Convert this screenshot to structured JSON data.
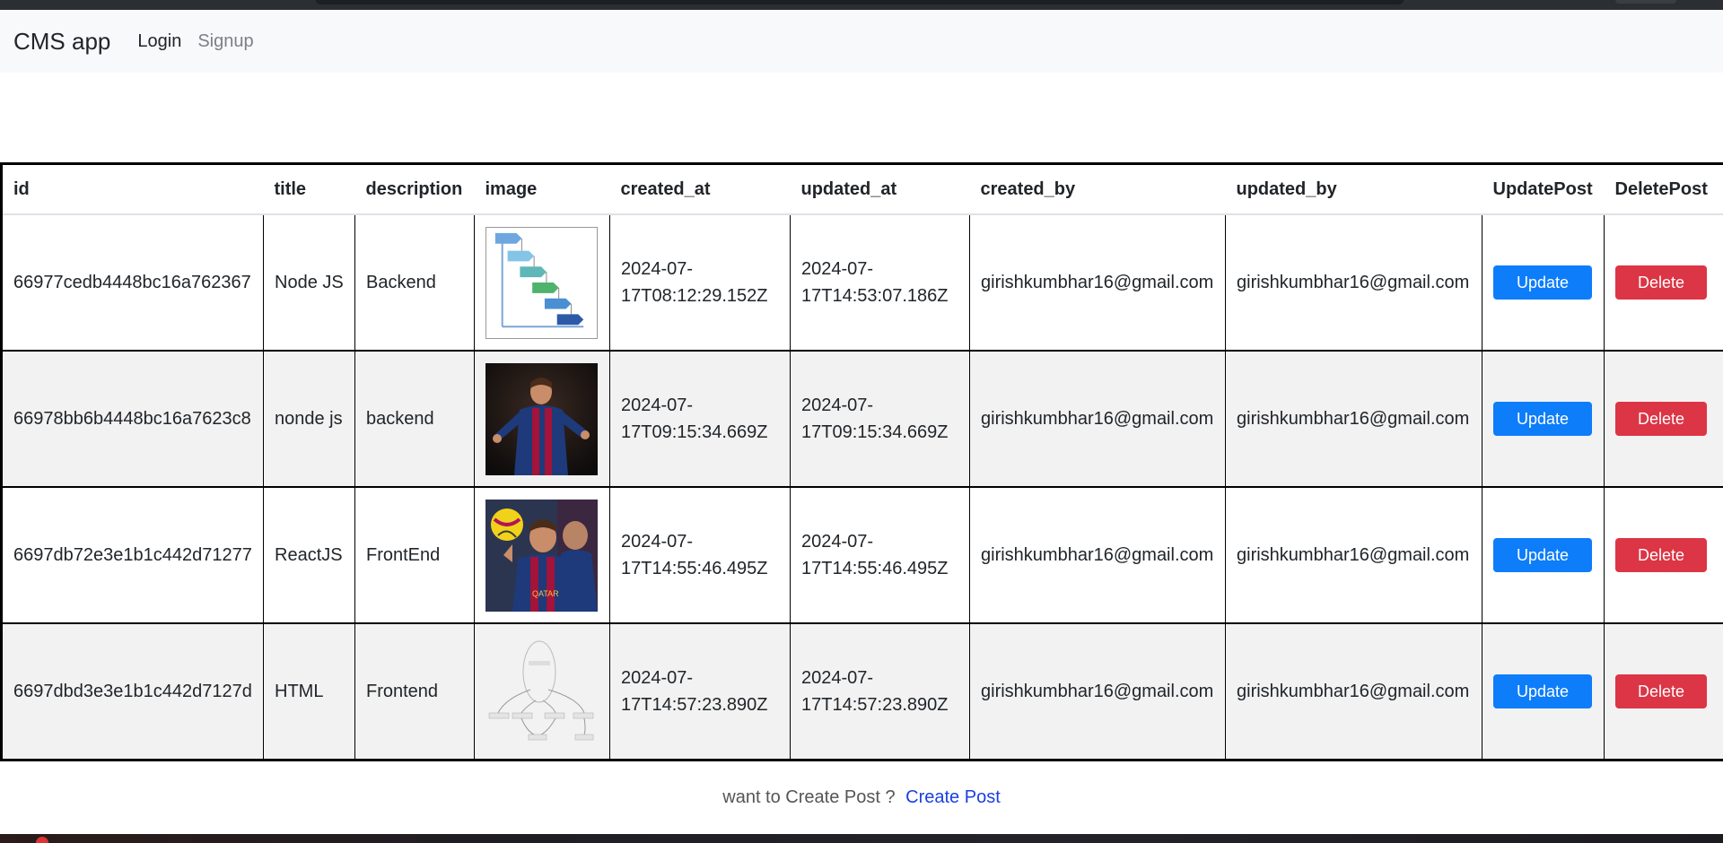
{
  "navbar": {
    "brand": "CMS app",
    "links": [
      "Login",
      "Signup"
    ]
  },
  "table": {
    "columns": [
      "id",
      "title",
      "description",
      "image",
      "created_at",
      "updated_at",
      "created_by",
      "updated_by",
      "UpdatePost",
      "DeletePost"
    ],
    "rows": [
      {
        "id": "66977cedb4448bc16a762367",
        "title": "Node JS",
        "description": "Backend",
        "image": "waterfall-diagram",
        "created_at": "2024-07-17T08:12:29.152Z",
        "updated_at": "2024-07-17T14:53:07.186Z",
        "created_by": "girishkumbhar16@gmail.com",
        "updated_by": "girishkumbhar16@gmail.com"
      },
      {
        "id": "66978bb6b4448bc16a7623c8",
        "title": "nonde js",
        "description": "backend",
        "image": "football-player-photo",
        "created_at": "2024-07-17T09:15:34.669Z",
        "updated_at": "2024-07-17T09:15:34.669Z",
        "created_by": "girishkumbhar16@gmail.com",
        "updated_by": "girishkumbhar16@gmail.com"
      },
      {
        "id": "6697db72e3e1b1c442d71277",
        "title": "ReactJS",
        "description": "FrontEnd",
        "image": "football-player-with-ball-photo",
        "created_at": "2024-07-17T14:55:46.495Z",
        "updated_at": "2024-07-17T14:55:46.495Z",
        "created_by": "girishkumbhar16@gmail.com",
        "updated_by": "girishkumbhar16@gmail.com"
      },
      {
        "id": "6697dbd3e3e1b1c442d7127d",
        "title": "HTML",
        "description": "Frontend",
        "image": "tree-diagram",
        "created_at": "2024-07-17T14:57:23.890Z",
        "updated_at": "2024-07-17T14:57:23.890Z",
        "created_by": "girishkumbhar16@gmail.com",
        "updated_by": "girishkumbhar16@gmail.com"
      }
    ],
    "update_label": "Update",
    "delete_label": "Delete"
  },
  "footer": {
    "prompt": "want to Create Post ?",
    "link": "Create Post"
  },
  "colors": {
    "update_button": "#0d7dfa",
    "delete_button": "#dc3545",
    "link": "#1a3fe0"
  }
}
